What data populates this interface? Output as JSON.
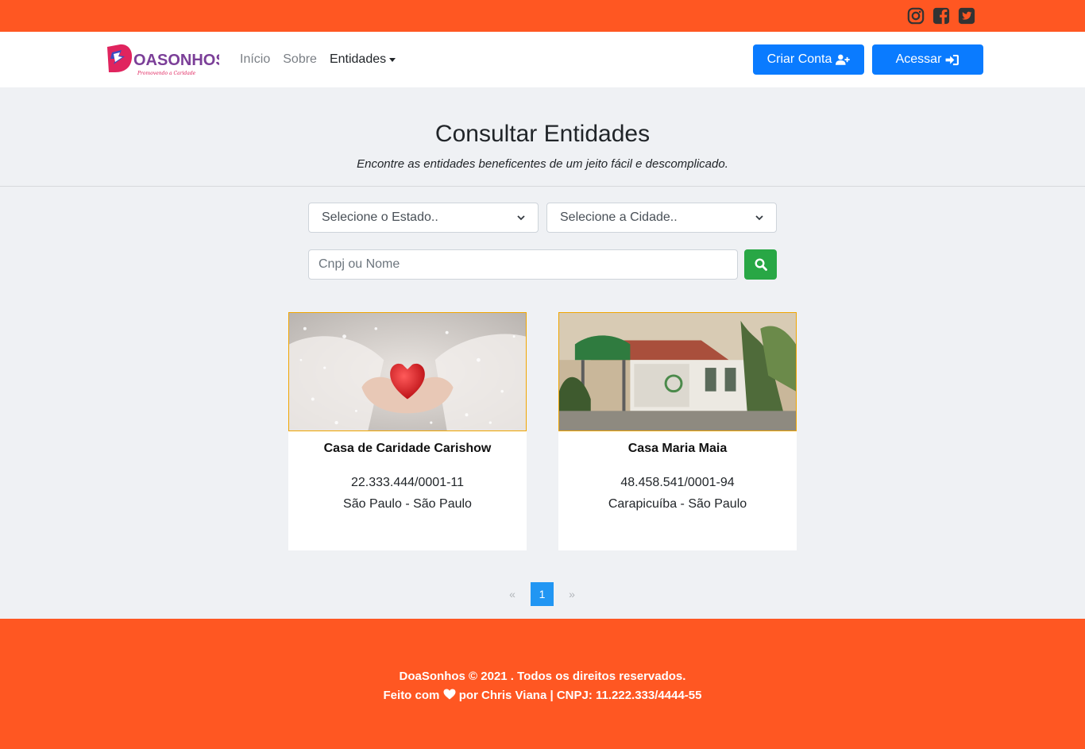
{
  "social": {
    "icons": [
      "instagram-icon",
      "facebook-icon",
      "twitter-icon"
    ],
    "color": "#333333"
  },
  "brand": {
    "logo_text": "OASONHOS",
    "tagline": "Promovendo a Caridade",
    "accent": "#ff5722",
    "primary": "#0a7bff",
    "success": "#28a745"
  },
  "nav": {
    "links": [
      "Início",
      "Sobre",
      "Entidades"
    ],
    "signup_label": "Criar Conta",
    "login_label": "Acessar"
  },
  "hero": {
    "title": "Consultar Entidades",
    "subtitle": "Encontre as entidades beneficentes de um jeito fácil e descomplicado."
  },
  "filters": {
    "state_selected": "Selecione o Estado..",
    "city_selected": "Selecione a Cidade..",
    "search_placeholder": "Cnpj ou Nome"
  },
  "entities": [
    {
      "name": "Casa de Caridade Carishow",
      "cnpj": "22.333.444/0001-11",
      "location": "São Paulo - São Paulo"
    },
    {
      "name": "Casa Maria Maia",
      "cnpj": "48.458.541/0001-94",
      "location": "Carapicuíba - São Paulo"
    }
  ],
  "pagination": {
    "prev": "«",
    "current": "1",
    "next": "»"
  },
  "footer": {
    "line1": "DoaSonhos © 2021 . Todos os direitos reservados.",
    "line2_pre": "Feito com",
    "line2_post": "por Chris Viana | CNPJ: 11.222.333/4444-55"
  }
}
